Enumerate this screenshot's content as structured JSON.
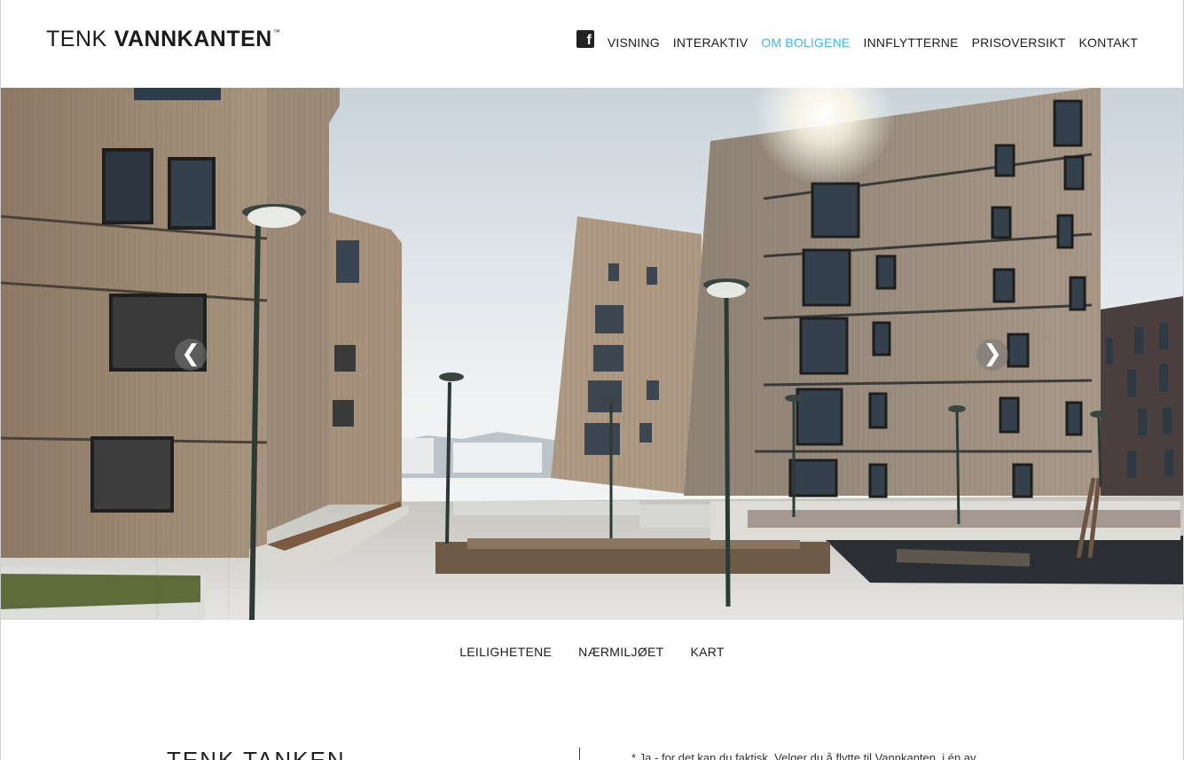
{
  "header": {
    "logo_light": "TENK",
    "logo_bold": "VANNKANTEN",
    "logo_tm": "™"
  },
  "nav": {
    "facebook_glyph": "f",
    "items": [
      {
        "label": "VISNING"
      },
      {
        "label": "INTERAKTIV"
      },
      {
        "label": "OM BOLIGENE"
      },
      {
        "label": "INNFLYTTERNE"
      },
      {
        "label": "PRISOVERSIKT"
      },
      {
        "label": "KONTAKT"
      }
    ],
    "active_color": "#3fb7e4"
  },
  "slider": {
    "prev_glyph": "❮",
    "next_glyph": "❯"
  },
  "subnav": {
    "items": [
      {
        "label": "LEILIGHETENE"
      },
      {
        "label": "NÆRMILJØET"
      },
      {
        "label": "KART"
      }
    ]
  },
  "teaser": {
    "logo": "TENK TANKEN",
    "text": "* Ja - for det kan du faktisk. Velger du å flytte til Vannkanten, i én av"
  }
}
